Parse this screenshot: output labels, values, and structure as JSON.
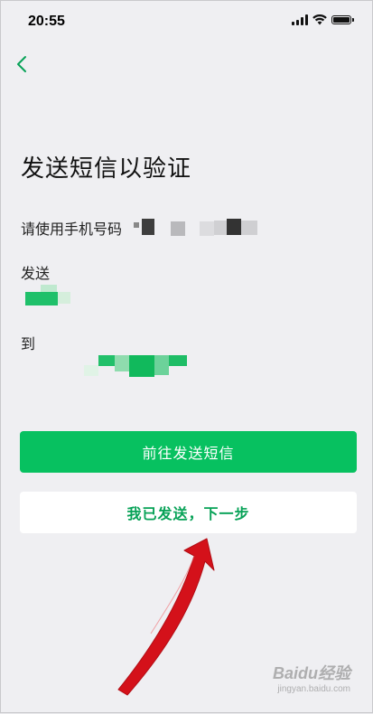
{
  "status_bar": {
    "time": "20:55",
    "icons": [
      "cellular-signal-icon",
      "wifi-icon",
      "battery-icon"
    ]
  },
  "nav": {
    "back_icon": "chevron-left-icon"
  },
  "page": {
    "title": "发送短信以验证",
    "instruction": "请使用手机号码",
    "send_label": "发送",
    "to_label": "到"
  },
  "buttons": {
    "primary": "前往发送短信",
    "secondary": "我已发送，下一步"
  },
  "watermark": {
    "logo": "Baidu经验",
    "url": "jingyan.baidu.com"
  },
  "colors": {
    "accent": "#07c160",
    "secondary_text": "#07a257",
    "background": "#efeff2",
    "annotation_arrow": "#d4111a"
  }
}
